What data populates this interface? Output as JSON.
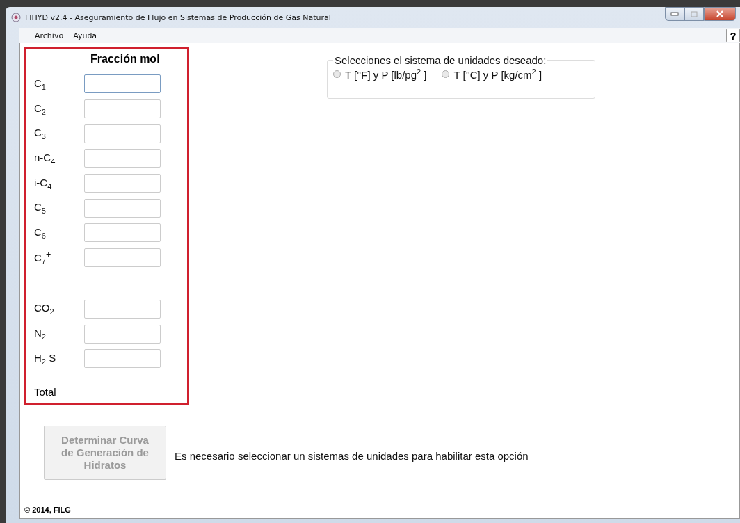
{
  "window": {
    "title": "FIHYD v2.4 - Aseguramiento de Flujo en Sistemas de Producción de Gas Natural"
  },
  "menu": [
    "Archivo",
    "Ayuda"
  ],
  "help_button": "?",
  "composition": {
    "heading": "Fracción mol",
    "components": [
      {
        "label": "C$_{1}$",
        "focused": true
      },
      {
        "label": "C$_{2}$",
        "focused": false
      },
      {
        "label": "C$_{3}$",
        "focused": false
      },
      {
        "label": "n-C$_{4}$",
        "focused": false
      },
      {
        "label": "i-C$_{4}$",
        "focused": false
      },
      {
        "label": "C$_{5}$",
        "focused": false
      },
      {
        "label": "C$_{6}$",
        "focused": false
      },
      {
        "label": "C$_{7}$$^{+}$",
        "focused": false
      }
    ],
    "gases": [
      {
        "label": "CO$_{2}$",
        "focused": false
      },
      {
        "label": "N$_{2}$",
        "focused": false
      },
      {
        "label": "H$_{2}$ S",
        "focused": false
      }
    ],
    "total_label": "Total"
  },
  "units": {
    "legend": "Selecciones el sistema de unidades deseado:",
    "options": [
      {
        "label": "T [°F] y P [lb/pg$^{2}$ ]",
        "selected": false
      },
      {
        "label": "T [°C] y P [kg/cm$^{2}$ ]",
        "selected": false
      }
    ]
  },
  "action_button": {
    "label": "Determinar Curva de Generación de Hidratos",
    "disabled": true
  },
  "message": "Es necesario seleccionar un sistemas de unidades para habilitar esta opción",
  "footer": "© 2014, FILG"
}
